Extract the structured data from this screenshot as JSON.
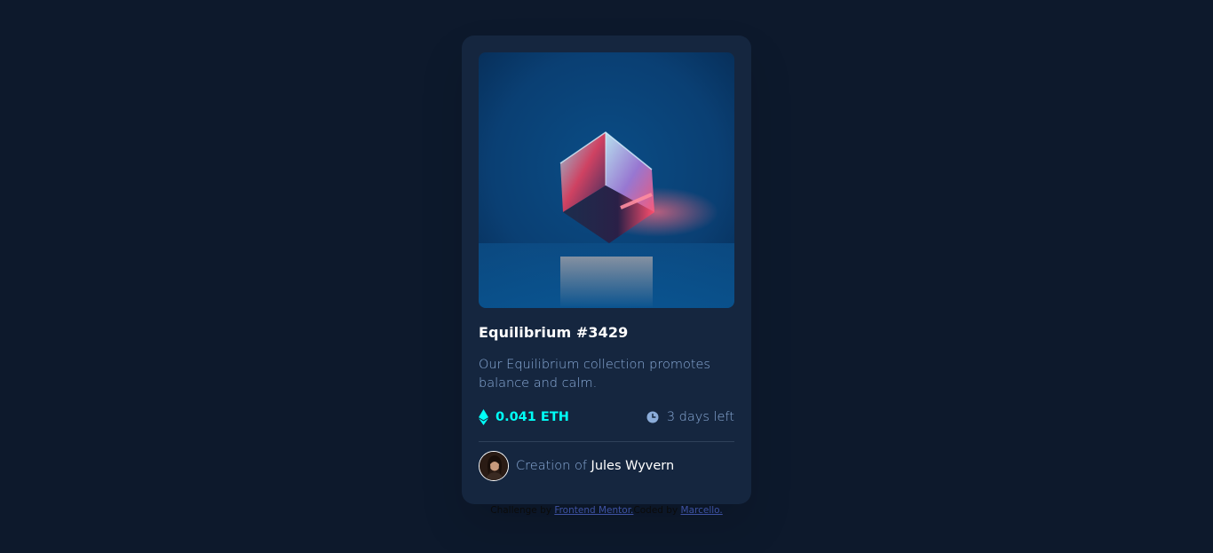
{
  "card": {
    "title": "Equilibrium #3429",
    "description": "Our Equilibrium collection promotes balance and calm.",
    "price": "0.041 ETH",
    "time_left": "3 days left",
    "creator_prefix": "Creation of",
    "creator_name": "Jules Wyvern"
  },
  "attribution": {
    "challenge_prefix": "Challenge by",
    "challenge_link": "Frontend Mentor.",
    "coded_prefix": "Coded by",
    "coded_link": "Marcello."
  },
  "colors": {
    "page_bg": "#0d192c",
    "card_bg": "#15263f",
    "accent_cyan": "#00fff7",
    "soft_blue": "#8bacd9",
    "white": "#ffffff"
  },
  "icons": [
    "ethereum-icon",
    "clock-icon"
  ]
}
